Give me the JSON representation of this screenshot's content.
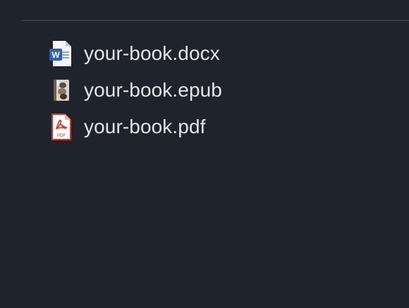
{
  "files": [
    {
      "name": "your-book.docx",
      "icon": "word-document-icon"
    },
    {
      "name": "your-book.epub",
      "icon": "epub-book-icon"
    },
    {
      "name": "your-book.pdf",
      "icon": "pdf-document-icon",
      "icon_badge": "PDF"
    }
  ],
  "colors": {
    "background": "#1f232b",
    "divider": "#343a44",
    "text": "#e3e5ea",
    "word_blue": "#2b5fbf",
    "pdf_red": "#e0301e"
  }
}
